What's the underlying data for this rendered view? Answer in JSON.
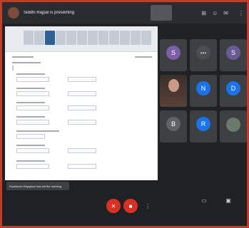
{
  "top_bar": {
    "presenter_text": "Siddhi Rajpal is presenting",
    "self_tile_text": "",
    "time_text": "",
    "icons": [
      "grid-view-icon",
      "people-icon",
      "chat-icon",
      "more-icon"
    ]
  },
  "shared_screen": {
    "toolbar_buttons": 12,
    "active_button": 2
  },
  "toast": {
    "text": "Rushikesh Rayapkar has left the meeting"
  },
  "participants": [
    {
      "name": "",
      "initial": "S",
      "color": "#7b5ea7",
      "kind": "avatar"
    },
    {
      "name": "",
      "initial": "",
      "color": "#4a4d52",
      "kind": "dots"
    },
    {
      "name": "",
      "initial": "S",
      "color": "#6b5b95",
      "kind": "avatar"
    },
    {
      "name": "",
      "initial": "",
      "color": "#c99a85",
      "kind": "video"
    },
    {
      "name": "",
      "initial": "N",
      "color": "#1a73e8",
      "kind": "avatar"
    },
    {
      "name": "",
      "initial": "D",
      "color": "#1a73e8",
      "kind": "avatar"
    },
    {
      "name": "",
      "initial": "B",
      "color": "#5f6368",
      "kind": "avatar"
    },
    {
      "name": "",
      "initial": "R",
      "color": "#1a73e8",
      "kind": "avatar"
    },
    {
      "name": "",
      "initial": "",
      "color": "#6c7a6e",
      "kind": "photo"
    }
  ],
  "bottom_bar": {
    "meeting_text": "",
    "side_buttons": [
      {
        "label": "",
        "icon": "captions-icon"
      },
      {
        "label": "",
        "icon": "present-now-icon"
      }
    ],
    "controls": [
      {
        "icon": "mic-off-icon",
        "style": "red"
      },
      {
        "icon": "camera-off-icon",
        "style": "red"
      },
      {
        "icon": "more-options-icon",
        "style": "plain"
      }
    ]
  }
}
